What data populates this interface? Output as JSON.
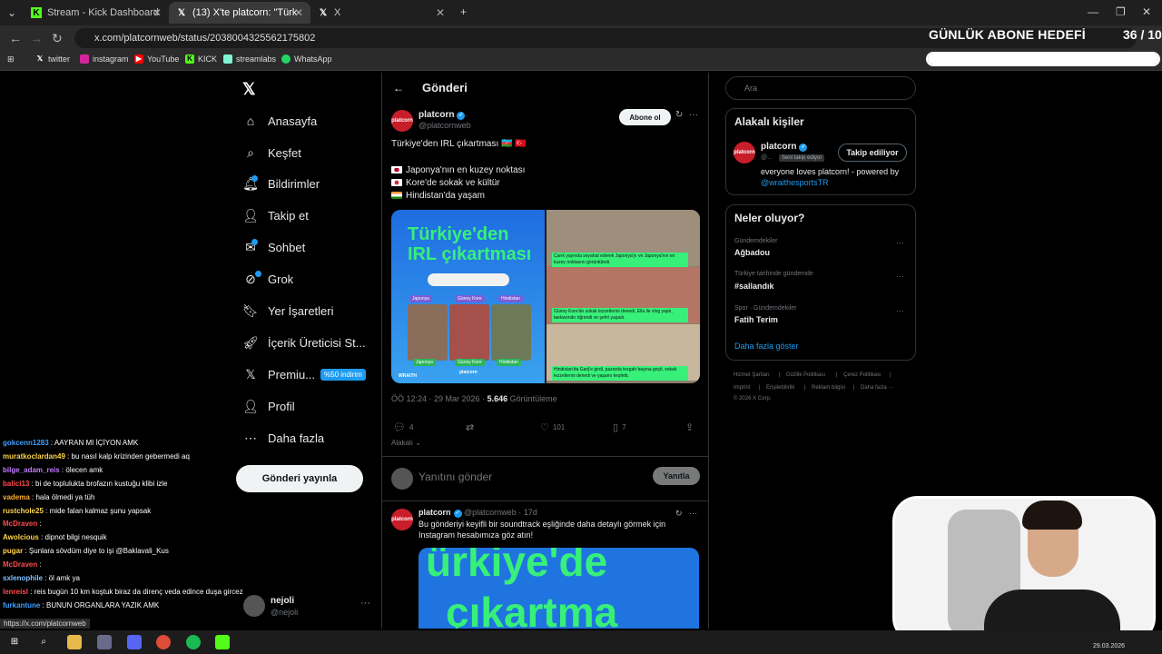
{
  "browser": {
    "tabs": [
      {
        "label": "Stream - Kick Dashboard",
        "icon": "kick-icon"
      },
      {
        "label": "(13) X'te platcorn: \"Türkiye'den",
        "icon": "x-icon"
      },
      {
        "label": "X",
        "icon": "x-icon"
      }
    ],
    "url": "x.com/platcornweb/status/2038004325562175802",
    "bookmarks": [
      "twitter",
      "instagram",
      "YouTube",
      "KICK",
      "streamlabs",
      "WhatsApp"
    ],
    "status_url": "https://x.com/platcornweb"
  },
  "overlay": {
    "abone_title": "GÜNLÜK ABONE HEDEFİ",
    "abone_count": "36 / 10",
    "abone_progress": 1.0
  },
  "nav": {
    "items": [
      "Anasayfa",
      "Keşfet",
      "Bildirimler",
      "Takip et",
      "Sohbet",
      "Grok",
      "Yer İşaretleri",
      "İçerik Üreticisi St...",
      "Premiu...",
      "Profil",
      "Daha fazla"
    ],
    "premium_badge": "%50 indirim",
    "post_button": "Gönderi yayınla",
    "user_name": "nejoli",
    "user_handle": "@nejoli"
  },
  "chat": [
    {
      "user": "gokcenn1283",
      "color": "#3fa0ff",
      "msg": " : AAYRAN MI İÇİYON AMK"
    },
    {
      "user": "muratkoclardan49",
      "color": "#ffd54a",
      "msg": " : bu nasıl kalp krizinden gebermedi aq"
    },
    {
      "user": "bilge_adam_reis",
      "color": "#c27cff",
      "msg": " : ölecen amk"
    },
    {
      "user": "balici13",
      "color": "#ff4d4d",
      "msg": " : bi de toplulukta brofazın kustuğu klibi izle"
    },
    {
      "user": "vadema",
      "color": "#ffb02e",
      "msg": " : hala ölmedi ya tüh"
    },
    {
      "user": "rustchole25",
      "color": "#ffd54a",
      "msg": " : mide falan kalmaz şunu yapsak"
    },
    {
      "user": "McDraven",
      "color": "#ff4d4d",
      "msg": " : "
    },
    {
      "user": "Awolcious",
      "color": "#ffd54a",
      "msg": " : dipnot bilgi nesquik"
    },
    {
      "user": "pugar",
      "color": "#ffd54a",
      "msg": " : Şunlara sövdüm diye to işi @Baklavali_Kus"
    },
    {
      "user": "McDraven",
      "color": "#ff4d4d",
      "msg": " : "
    },
    {
      "user": "sxlenophile",
      "color": "#7fc3ff",
      "msg": " : öl amk ya"
    },
    {
      "user": "lenreisl",
      "color": "#ff4d4d",
      "msg": " : reis bugün 10 km koştuk biraz da direnç veda edince duşa gircez"
    },
    {
      "user": "furkantune",
      "color": "#3fa0ff",
      "msg": " : BUNUN ORGANLARA YAZIK AMK"
    }
  ],
  "post": {
    "header_title": "Gönderi",
    "name": "platcorn",
    "handle": "@platcornweb",
    "follow_label": "Abone ol",
    "lines": [
      "Türkiye'den IRL çıkartması 🇦🇿 🇹🇷",
      "Japonya'nın en kuzey noktası",
      "Kore'de sokak ve kültür",
      "Hindistan'da yaşam"
    ],
    "media": {
      "title1": "Türkiye'den",
      "title2": "IRL çıkartması",
      "tags": [
        "Japonya",
        "Güney Kore",
        "Hindistan"
      ],
      "labels": [
        "Japonya",
        "Güney Kore",
        "Hindistan"
      ],
      "brand_left": "WRAITH",
      "brand_mid": "platcorn",
      "captions": [
        "Çarık yayında seyahat ederek Japonya'yı ve Japonya'nın en kuzey noktasını görüntüledi.",
        "Güney Kore'de sokak lezzetlerini denedi, Ella ile vlog yaptı, taekwondo öğrendi ve şehri yaşadı.",
        "Hindistan'da Garij'e girdi, pazarda tezgah başına geçti, sokak lezzetlerini denedi ve yaşamı keşfetti."
      ]
    },
    "time": "ÖÖ 12:24 · 29 Mar 2026 · ",
    "views": "5.646",
    "views_label": " Görüntüleme",
    "replies": "4",
    "likes": "101",
    "bookmarks": "7",
    "alakali": "Alakalı",
    "reply_placeholder": "Yanıtını gönder",
    "reply_button": "Yanıtla"
  },
  "post2": {
    "name": "platcorn",
    "handle": "@platcornweb · 17d",
    "line1": "Bu gönderiyi keyifli bir soundtrack eşliğinde daha detaylı görmek için",
    "line2": "Instagram hesabımıza göz atın!",
    "media1": "ürkiye'de",
    "media2": "çıkartma"
  },
  "right": {
    "search_placeholder": "Ara",
    "related_title": "Alakalı kişiler",
    "r_name": "platcorn",
    "r_handle": "@...",
    "r_badge": "Seni takip ediyor",
    "r_follow": "Takip ediliyor",
    "r_bio": "everyone loves platcorn! - powered by",
    "r_bio_link": "@wraithesportsTR",
    "trends_title": "Neler oluyor?",
    "trends": [
      {
        "cat": "Gündemdekiler",
        "name": "Ağbadou"
      },
      {
        "cat": "Türkiye tarihinde gündemde",
        "name": "#sallandık"
      },
      {
        "cat": "Spor · Gündemdekiler",
        "name": "Fatih Terim"
      }
    ],
    "show_more": "Daha fazla göster",
    "footer": [
      "Hizmet Şartları",
      "|",
      "Gizlilik Politikası",
      "|",
      "Çerez Politikası",
      "|",
      "Imprint",
      "|",
      "Erişilebilirlik",
      "|",
      "Reklam bilgisi",
      "|",
      "Daha fazla ···",
      "© 2026 X Corp."
    ]
  },
  "taskbar": {
    "date": "29.03.2026"
  },
  "colors": {
    "accent": "#1d9bf0",
    "neon_green": "#37f07a"
  }
}
